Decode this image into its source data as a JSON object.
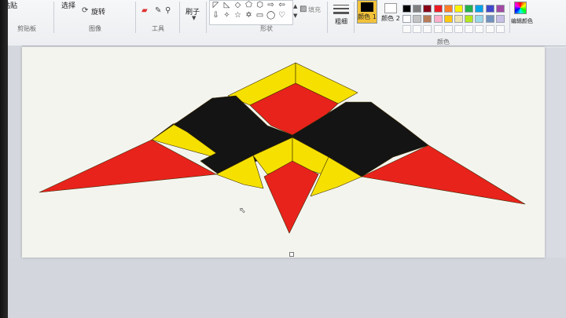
{
  "ribbon": {
    "groups": {
      "clipboard": "剪贴板",
      "image": "图像",
      "tools": "工具",
      "shapes": "形状",
      "colors": "颜色"
    },
    "buttons": {
      "paste": "粘贴",
      "select": "选择",
      "rotate": "旋转",
      "brushes": "刷子",
      "fill": "填充",
      "size": "粗细",
      "color1": "颜色 1",
      "color2": "颜色 2",
      "edit_colors": "编辑颜色"
    }
  },
  "palette": {
    "row1": [
      "#000000",
      "#7f7f7f",
      "#880015",
      "#ed1c24",
      "#ff7f27",
      "#fff200",
      "#22b14c",
      "#00a2e8",
      "#3f48cc",
      "#a349a4"
    ],
    "row2": [
      "#ffffff",
      "#c3c3c3",
      "#b97a57",
      "#ffaec9",
      "#ffc90e",
      "#efe4b0",
      "#b5e61d",
      "#99d9ea",
      "#7092be",
      "#c8bfe7"
    ],
    "color1": "#000000",
    "color2": "#ffffff"
  },
  "kite_colors": {
    "red": "#e8231c",
    "yellow": "#f5e000",
    "black": "#141414"
  }
}
